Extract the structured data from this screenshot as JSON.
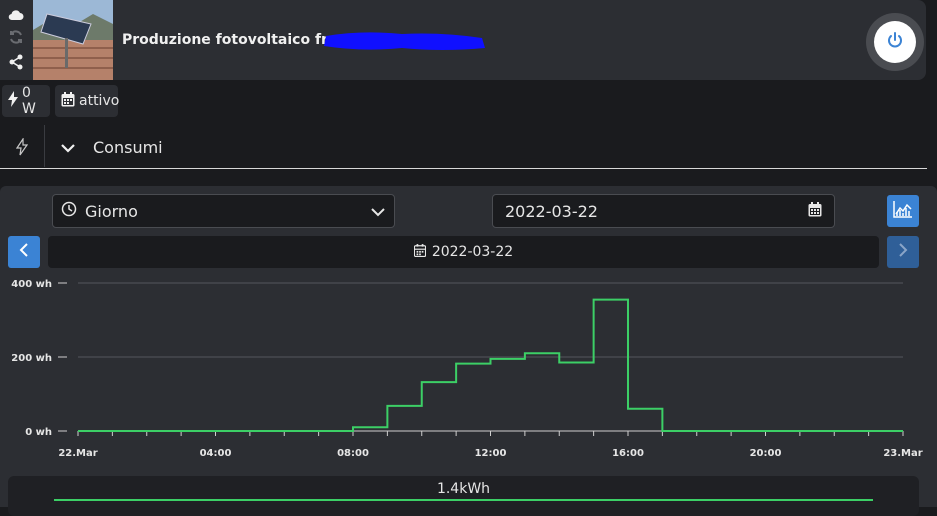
{
  "header": {
    "title": "Produzione fotovoltaico from",
    "side_icons": [
      "cloud-icon",
      "refresh-icon",
      "share-icon"
    ],
    "power_button_icon": "power-icon"
  },
  "badges": [
    {
      "icon": "bolt-icon",
      "label": "0 W"
    },
    {
      "icon": "calendar-icon",
      "label": "attivo"
    }
  ],
  "section": {
    "icon": "bolt-outline-icon",
    "title": "Consumi",
    "expanded": true
  },
  "controls": {
    "period_select": {
      "icon": "clock-icon",
      "value": "Giorno"
    },
    "date_input": {
      "value": "2022-03-22"
    },
    "current_date": "2022-03-22"
  },
  "colors": {
    "accent": "#3b83d4",
    "series": "#3ccf66",
    "panel": "#2c2e33",
    "background": "#1a1b1e"
  },
  "chart_data": {
    "type": "line",
    "step": true,
    "x_ticks": [
      "22.Mar",
      "04:00",
      "08:00",
      "12:00",
      "16:00",
      "20:00",
      "23.Mar"
    ],
    "y_ticks": [
      "0 wh",
      "200 wh",
      "400 wh"
    ],
    "ylim": [
      0,
      400
    ],
    "grid": true,
    "series": [
      {
        "x": [
          0,
          1,
          2,
          3,
          4,
          5,
          6,
          7,
          8,
          9,
          10,
          11,
          12,
          13,
          14,
          15,
          16,
          17,
          18,
          19,
          20,
          21,
          22,
          23
        ],
        "values": [
          0,
          0,
          0,
          0,
          0,
          0,
          0,
          0,
          10,
          68,
          132,
          182,
          195,
          210,
          185,
          355,
          60,
          0,
          0,
          0,
          0,
          0,
          0,
          0
        ]
      }
    ]
  },
  "total": {
    "label": "1.4kWh"
  }
}
